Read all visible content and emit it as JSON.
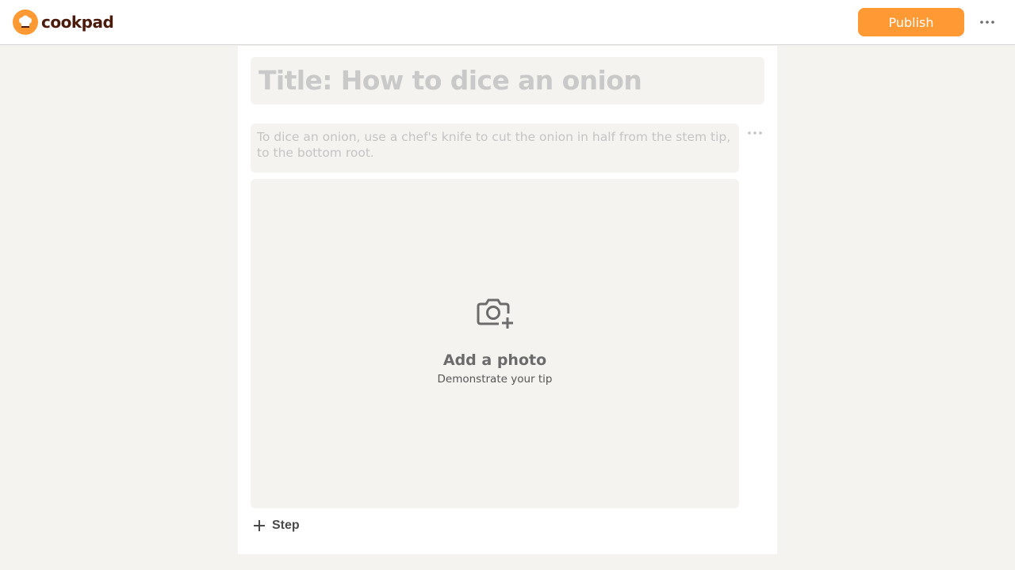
{
  "header": {
    "logo_text": "cookpad",
    "publish_label": "Publish",
    "more_icon": "ellipsis-icon"
  },
  "editor": {
    "title_placeholder": "Title: How to dice an onion",
    "description_placeholder": "To dice an onion, use a chef's knife to cut the onion in half from the stem tip, to the bottom root.",
    "photo_title": "Add a photo",
    "photo_subtitle": "Demonstrate your tip",
    "step_label": "Step"
  },
  "colors": {
    "brand_orange": "#ff9933",
    "background": "#f4f3ef",
    "placeholder": "#c9c9c9"
  }
}
